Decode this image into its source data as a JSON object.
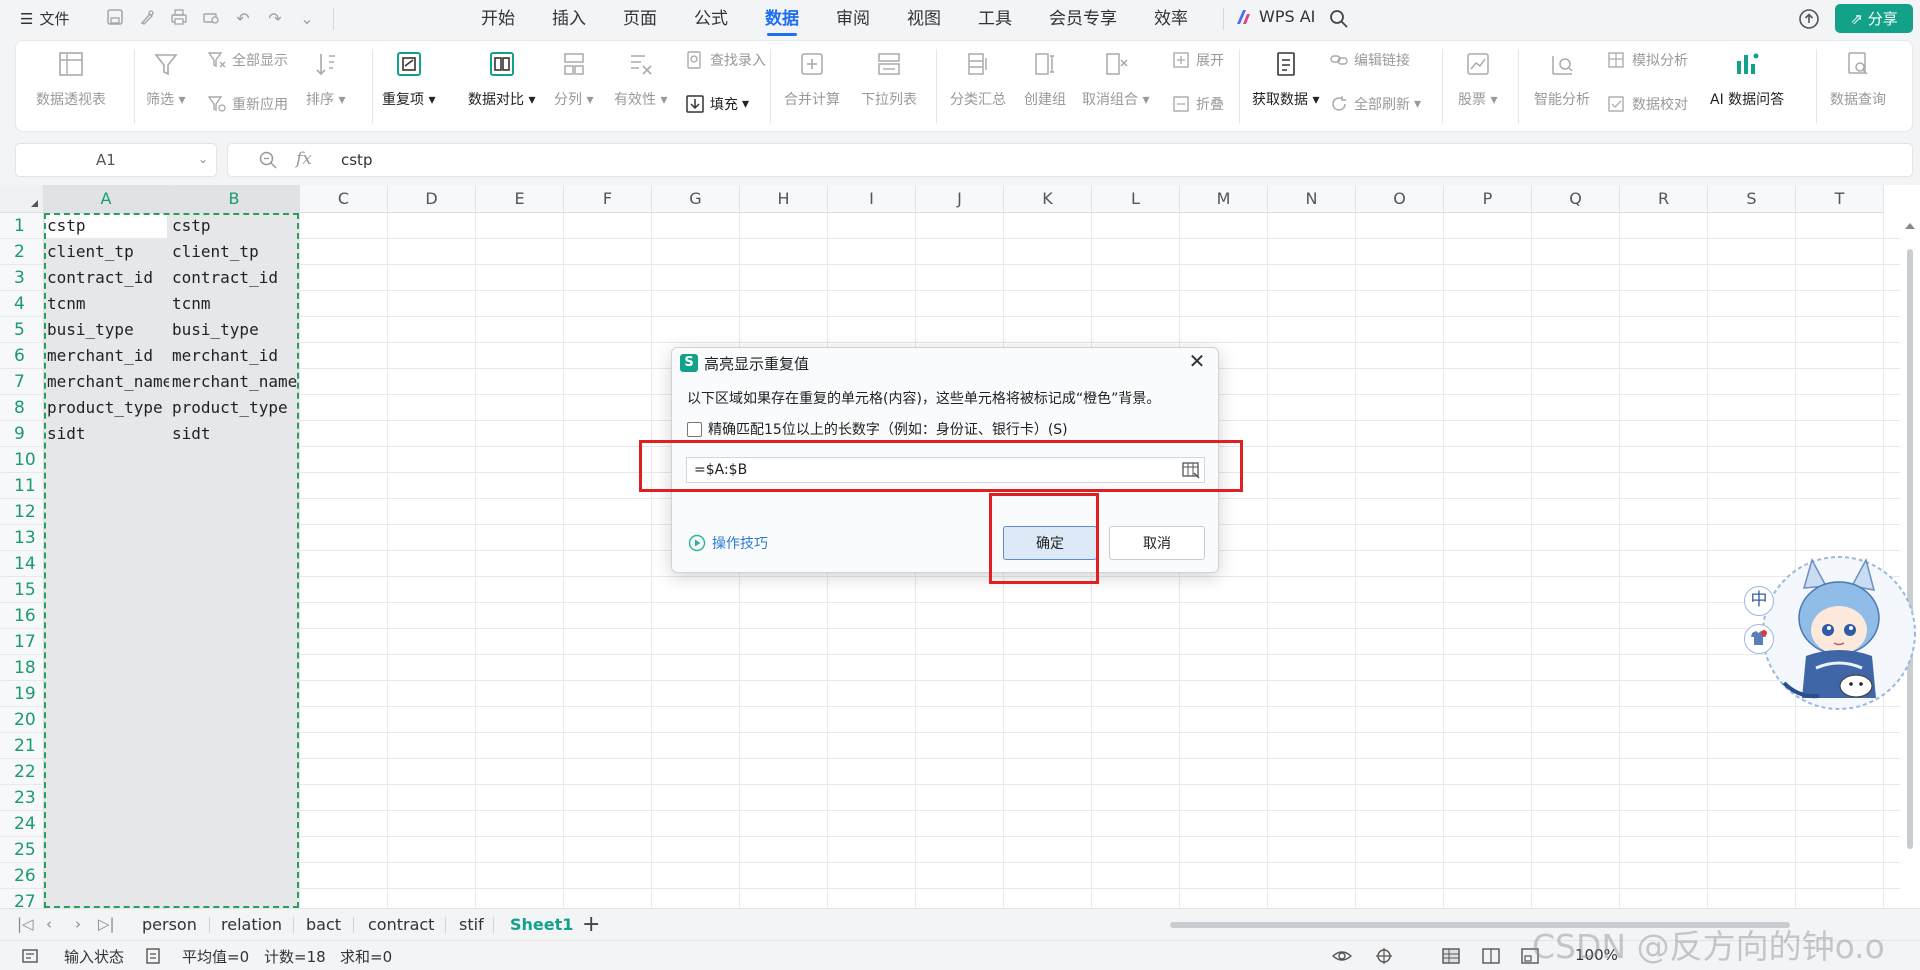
{
  "menubar": {
    "file_label": "文件",
    "tabs": [
      {
        "label": "开始",
        "active": false
      },
      {
        "label": "插入",
        "active": false
      },
      {
        "label": "页面",
        "active": false
      },
      {
        "label": "公式",
        "active": false
      },
      {
        "label": "数据",
        "active": true
      },
      {
        "label": "审阅",
        "active": false
      },
      {
        "label": "视图",
        "active": false
      },
      {
        "label": "工具",
        "active": false
      },
      {
        "label": "会员专享",
        "active": false
      },
      {
        "label": "效率",
        "active": false
      }
    ],
    "wps_ai_label": "WPS AI",
    "share_label": "分享",
    "accent_color": "#1f6ff2",
    "share_color": "#13a18a"
  },
  "ribbon": {
    "pivot": "数据透视表",
    "filter": "筛选",
    "show_all": "全部显示",
    "reapply": "重新应用",
    "sort": "排序",
    "duplicates": "重复项",
    "compare": "数据对比",
    "split": "分列",
    "validity": "有效性",
    "lookup_entry": "查找录入",
    "fill": "填充",
    "consolidate": "合并计算",
    "dropdown_list": "下拉列表",
    "subtotal": "分类汇总",
    "group": "创建组",
    "ungroup": "取消组合",
    "expand": "展开",
    "collapse": "折叠",
    "get_data": "获取数据",
    "edit_links": "编辑链接",
    "refresh_all": "全部刷新",
    "stocks": "股票",
    "smart_analysis": "智能分析",
    "simulation": "模拟分析",
    "data_check": "数据校对",
    "ai_qa": "AI 数据问答",
    "data_query": "数据查询"
  },
  "formula_bar": {
    "cell_ref": "A1",
    "fx_label": "fx",
    "value": "cstp"
  },
  "grid": {
    "columns": [
      "A",
      "B",
      "C",
      "D",
      "E",
      "F",
      "G",
      "H",
      "I",
      "J",
      "K",
      "L",
      "M",
      "N",
      "O",
      "P",
      "Q",
      "R",
      "S",
      "T"
    ],
    "rows": [
      "1",
      "2",
      "3",
      "4",
      "5",
      "6",
      "7",
      "8",
      "9",
      "10",
      "11",
      "12",
      "13",
      "14",
      "15",
      "16",
      "17",
      "18",
      "19",
      "20",
      "21",
      "22",
      "23",
      "24",
      "25",
      "26",
      "27"
    ],
    "col_a": [
      "cstp",
      "client_tp",
      "contract_id",
      "tcnm",
      "busi_type",
      "merchant_id",
      "merchant_name",
      "product_type",
      "sidt"
    ],
    "col_b": [
      "cstp",
      "client_tp",
      "contract_id",
      "tcnm",
      "busi_type",
      "merchant_id",
      "merchant_name",
      "product_type",
      "sidt"
    ]
  },
  "sheets": {
    "tabs": [
      {
        "label": "person",
        "active": false
      },
      {
        "label": "relation",
        "active": false
      },
      {
        "label": "bact",
        "active": false
      },
      {
        "label": "contract",
        "active": false
      },
      {
        "label": "stif",
        "active": false
      },
      {
        "label": "Sheet1",
        "active": true
      }
    ],
    "add_label": "+"
  },
  "status": {
    "input_state": "输入状态",
    "average": "平均值=0",
    "count": "计数=18",
    "sum": "求和=0",
    "zoom": "100%",
    "watermark": "CSDN @反方向的钟o.o"
  },
  "dialog": {
    "icon_label": "S",
    "title": "高亮显示重复值",
    "description": "以下区域如果存在重复的单元格(内容)，这些单元格将被标记成“橙色”背景。",
    "checkbox_label": "精确匹配15位以上的长数字（例如：身份证、银行卡）(S)",
    "checkbox_checked": false,
    "range_value": "=$A:$B",
    "tips_label": "操作技巧",
    "ok_label": "确定",
    "cancel_label": "取消",
    "annotation_color": "#e02020"
  },
  "mascot": {
    "badge_zh": "中"
  }
}
